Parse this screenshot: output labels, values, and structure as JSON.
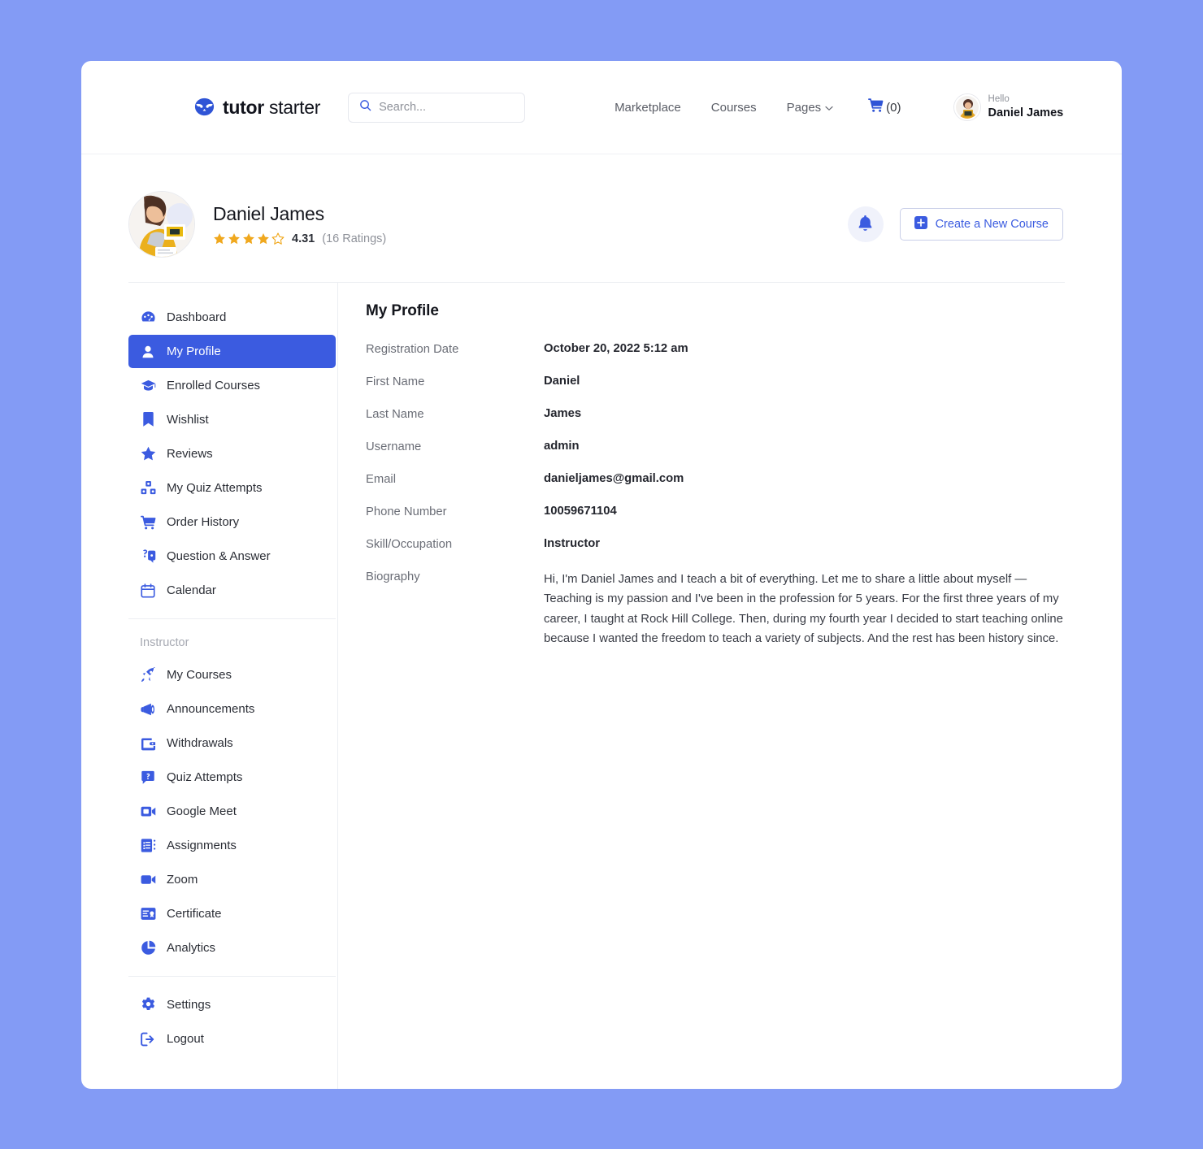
{
  "brand": {
    "name_bold": "tutor",
    "name_light": "starter",
    "logo_icon": "owl-icon"
  },
  "search": {
    "placeholder": "Search...",
    "value": "",
    "icon": "search-icon"
  },
  "topnav": {
    "links": [
      {
        "label": "Marketplace",
        "has_dropdown": false
      },
      {
        "label": "Courses",
        "has_dropdown": false
      },
      {
        "label": "Pages",
        "has_dropdown": true,
        "chevron": "chevron-down-icon"
      }
    ],
    "cart": {
      "icon": "cart-icon",
      "count_label": "(0)"
    },
    "user": {
      "greeting": "Hello",
      "name": "Daniel James",
      "avatar": "user-avatar"
    }
  },
  "profile_bar": {
    "avatar": "profile-avatar",
    "name": "Daniel James",
    "rating_value": "4.31",
    "rating_count": "(16 Ratings)",
    "stars_filled": 4,
    "stars_total": 5,
    "notification_icon": "bell-icon",
    "create_button": {
      "label": "Create a New Course",
      "icon": "plus-square-icon"
    }
  },
  "sidebar": {
    "primary": [
      {
        "label": "Dashboard",
        "icon": "dashboard-icon",
        "active": false
      },
      {
        "label": "My Profile",
        "icon": "user-icon",
        "active": true
      },
      {
        "label": "Enrolled Courses",
        "icon": "graduation-cap-icon",
        "active": false
      },
      {
        "label": "Wishlist",
        "icon": "bookmark-icon",
        "active": false
      },
      {
        "label": "Reviews",
        "icon": "star-icon",
        "active": false
      },
      {
        "label": "My Quiz Attempts",
        "icon": "quiz-blocks-icon",
        "active": false
      },
      {
        "label": "Order History",
        "icon": "cart-icon",
        "active": false
      },
      {
        "label": "Question & Answer",
        "icon": "question-answer-icon",
        "active": false
      },
      {
        "label": "Calendar",
        "icon": "calendar-icon",
        "active": false
      }
    ],
    "instructor_title": "Instructor",
    "instructor": [
      {
        "label": "My Courses",
        "icon": "rocket-icon"
      },
      {
        "label": "Announcements",
        "icon": "megaphone-icon"
      },
      {
        "label": "Withdrawals",
        "icon": "wallet-icon"
      },
      {
        "label": "Quiz Attempts",
        "icon": "quiz-question-icon"
      },
      {
        "label": "Google Meet",
        "icon": "video-camera-icon"
      },
      {
        "label": "Assignments",
        "icon": "assignment-list-icon"
      },
      {
        "label": "Zoom",
        "icon": "zoom-camera-icon"
      },
      {
        "label": "Certificate",
        "icon": "certificate-icon"
      },
      {
        "label": "Analytics",
        "icon": "pie-chart-icon"
      }
    ],
    "footer": [
      {
        "label": "Settings",
        "icon": "gear-icon"
      },
      {
        "label": "Logout",
        "icon": "logout-icon"
      }
    ]
  },
  "main": {
    "title": "My Profile",
    "fields": [
      {
        "label": "Registration Date",
        "value": "October 20, 2022 5:12 am",
        "multiline": false
      },
      {
        "label": "First Name",
        "value": "Daniel",
        "multiline": false
      },
      {
        "label": "Last Name",
        "value": "James",
        "multiline": false
      },
      {
        "label": "Username",
        "value": "admin",
        "multiline": false
      },
      {
        "label": "Email",
        "value": "danieljames@gmail.com",
        "multiline": false
      },
      {
        "label": "Phone Number",
        "value": "10059671104",
        "multiline": false
      },
      {
        "label": "Skill/Occupation",
        "value": "Instructor",
        "multiline": false
      },
      {
        "label": "Biography",
        "value": "Hi, I'm Daniel James and I teach a bit of everything. Let me to share a little about myself — Teaching is my passion and I've been in the profession for 5 years. For the first three years of my career, I taught at Rock Hill College. Then, during my fourth year I decided to start teaching online because I wanted the freedom to teach a variety of subjects. And the rest has been history since.",
        "multiline": true
      }
    ]
  },
  "colors": {
    "page_background": "#839bf5",
    "accent_blue": "#3b5be0",
    "star_amber": "#f0a81e",
    "card_white": "#ffffff"
  }
}
